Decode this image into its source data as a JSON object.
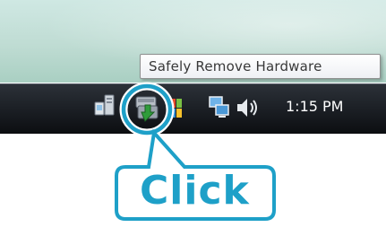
{
  "tooltip": {
    "text": "Safely Remove Hardware"
  },
  "tray": {
    "clock": "1:15 PM",
    "icons": [
      "network-icon",
      "safely-remove-hardware-icon",
      "windows-defender-icon",
      "network-status-icon",
      "volume-icon"
    ]
  },
  "callout": {
    "label": "Click",
    "color": "#1ea0c8",
    "highlights": "safely-remove-hardware-icon"
  },
  "colors": {
    "taskbar": "#1d2127",
    "desktop": "#bfdcd3",
    "accent": "#1ea0c8"
  }
}
